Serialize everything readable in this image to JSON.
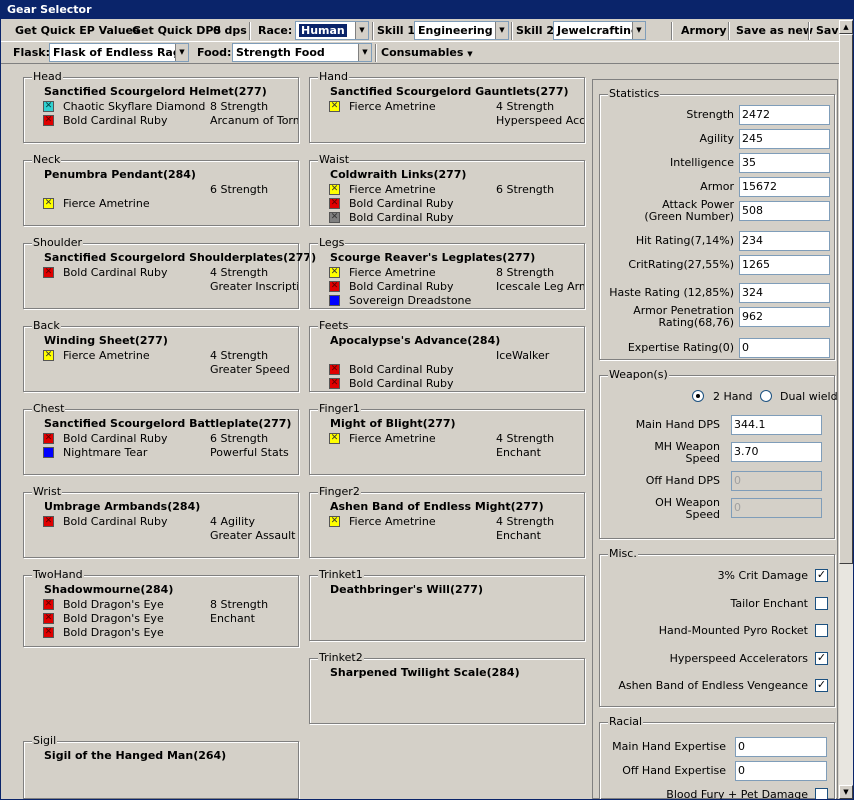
{
  "window": {
    "title": "Gear Selector"
  },
  "toolbar1": {
    "get_quick_ep": "Get Quick EP Values",
    "get_quick_dps": "Get Quick DPS",
    "dps_value": "0 dps",
    "race_label": "Race:",
    "race_value": "Human",
    "skill1_label": "Skill 1:",
    "skill1_value": "Engineering",
    "skill2_label": "Skill 2:",
    "skill2_value": "Jewelcrafting",
    "armory": "Armory",
    "save_as_new": "Save as new",
    "save": "Save"
  },
  "toolbar2": {
    "flask_label": "Flask:",
    "flask_value": "Flask of Endless Rage",
    "food_label": "Food:",
    "food_value": "Strength Food",
    "consumables": "Consumables"
  },
  "slots": {
    "head": {
      "label": "Head",
      "item": "Sanctified Scourgelord Helmet(277)",
      "gems": [
        {
          "color": "meta",
          "name": "Chaotic Skyflare Diamond"
        },
        {
          "color": "red",
          "name": "Bold Cardinal Ruby"
        }
      ],
      "right": [
        "8 Strength",
        "Arcanum of Torment"
      ]
    },
    "hand": {
      "label": "Hand",
      "item": "Sanctified Scourgelord Gauntlets(277)",
      "gems": [
        {
          "color": "yellow",
          "name": "Fierce Ametrine"
        }
      ],
      "right": [
        "4 Strength",
        "Hyperspeed Accelerators"
      ]
    },
    "neck": {
      "label": "Neck",
      "item": "Penumbra Pendant(284)",
      "gems": [
        {
          "color": "yellow",
          "name": "Fierce Ametrine"
        }
      ],
      "right": [
        "6 Strength"
      ]
    },
    "waist": {
      "label": "Waist",
      "item": "Coldwraith Links(277)",
      "gems": [
        {
          "color": "yellow",
          "name": "Fierce Ametrine"
        },
        {
          "color": "red",
          "name": "Bold Cardinal Ruby"
        },
        {
          "color": "prism",
          "name": "Bold Cardinal Ruby"
        }
      ],
      "right": [
        "6 Strength"
      ]
    },
    "shoulder": {
      "label": "Shoulder",
      "item": "Sanctified Scourgelord Shoulderplates(277)",
      "gems": [
        {
          "color": "red",
          "name": "Bold Cardinal Ruby"
        }
      ],
      "right": [
        "4 Strength",
        "Greater Inscription of the Axe"
      ]
    },
    "legs": {
      "label": "Legs",
      "item": "Scourge Reaver's Legplates(277)",
      "gems": [
        {
          "color": "yellow",
          "name": "Fierce Ametrine"
        },
        {
          "color": "red",
          "name": "Bold Cardinal Ruby"
        },
        {
          "color": "blue",
          "name": "Sovereign Dreadstone"
        }
      ],
      "right": [
        "8 Strength",
        "Icescale Leg Armor"
      ]
    },
    "back": {
      "label": "Back",
      "item": "Winding Sheet(277)",
      "gems": [
        {
          "color": "yellow",
          "name": "Fierce Ametrine"
        }
      ],
      "right": [
        "4 Strength",
        "Greater Speed"
      ]
    },
    "feet": {
      "label": "Feets",
      "item": "Apocalypse's Advance(284)",
      "gems": [
        {
          "color": "red",
          "name": "Bold Cardinal Ruby"
        },
        {
          "color": "red",
          "name": "Bold Cardinal Ruby"
        }
      ],
      "right": [
        "IceWalker"
      ]
    },
    "chest": {
      "label": "Chest",
      "item": "Sanctified Scourgelord Battleplate(277)",
      "gems": [
        {
          "color": "red",
          "name": "Bold Cardinal Ruby"
        },
        {
          "color": "blue",
          "name": "Nightmare Tear"
        }
      ],
      "right": [
        "6 Strength",
        "Powerful Stats"
      ]
    },
    "finger1": {
      "label": "Finger1",
      "item": "Might of Blight(277)",
      "gems": [
        {
          "color": "yellow",
          "name": "Fierce Ametrine"
        }
      ],
      "right": [
        "4 Strength",
        "Enchant"
      ]
    },
    "wrist": {
      "label": "Wrist",
      "item": "Umbrage Armbands(284)",
      "gems": [
        {
          "color": "red",
          "name": "Bold Cardinal Ruby"
        }
      ],
      "right": [
        "4 Agility",
        "Greater Assault"
      ]
    },
    "finger2": {
      "label": "Finger2",
      "item": "Ashen Band of Endless Might(277)",
      "gems": [
        {
          "color": "yellow",
          "name": "Fierce Ametrine"
        }
      ],
      "right": [
        "4 Strength",
        "Enchant"
      ]
    },
    "twohand": {
      "label": "TwoHand",
      "item": "Shadowmourne(284)",
      "gems": [
        {
          "color": "red",
          "name": "Bold Dragon's Eye"
        },
        {
          "color": "red",
          "name": "Bold Dragon's Eye"
        },
        {
          "color": "red",
          "name": "Bold Dragon's Eye"
        }
      ],
      "right": [
        "8 Strength",
        "Enchant"
      ]
    },
    "trinket1": {
      "label": "Trinket1",
      "item": "Deathbringer's Will(277)",
      "gems": [],
      "right": []
    },
    "trinket2": {
      "label": "Trinket2",
      "item": "Sharpened Twilight Scale(284)",
      "gems": [],
      "right": []
    },
    "sigil": {
      "label": "Sigil",
      "item": "Sigil of the Hanged Man(264)",
      "gems": [],
      "right": []
    }
  },
  "statistics": {
    "title": "Statistics",
    "rows": [
      {
        "label": "Strength",
        "value": "2472"
      },
      {
        "label": "Agility",
        "value": "245"
      },
      {
        "label": "Intelligence",
        "value": "35"
      },
      {
        "label": "Armor",
        "value": "15672"
      },
      {
        "label": "Attack Power\n(Green Number)",
        "value": "508"
      },
      {
        "label": "Hit Rating(7,14%)",
        "value": "234"
      },
      {
        "label": "CritRating(27,55%)",
        "value": "1265"
      },
      {
        "label": "Haste Rating (12,85%)",
        "value": "324"
      },
      {
        "label": "Armor Penetration\nRating(68,76)",
        "value": "962"
      },
      {
        "label": "Expertise Rating(0)",
        "value": "0"
      }
    ]
  },
  "weapons": {
    "title": "Weapon(s)",
    "two_hand": "2 Hand",
    "dual_wield": "Dual wield",
    "main_hand_dps_label": "Main Hand DPS",
    "main_hand_dps": "344.1",
    "mh_speed_label": "MH Weapon\nSpeed",
    "mh_speed": "3.70",
    "off_hand_dps_label": "Off Hand DPS",
    "off_hand_dps": "0",
    "oh_speed_label": "OH Weapon\nSpeed",
    "oh_speed": "0"
  },
  "misc": {
    "title": "Misc.",
    "items": [
      {
        "label": "3% Crit Damage",
        "checked": true
      },
      {
        "label": "Tailor Enchant",
        "checked": false
      },
      {
        "label": "Hand-Mounted Pyro Rocket",
        "checked": false
      },
      {
        "label": "Hyperspeed Accelerators",
        "checked": true
      },
      {
        "label": "Ashen Band of Endless Vengeance",
        "checked": true
      }
    ]
  },
  "racial": {
    "title": "Racial",
    "main_hand_expertise_label": "Main Hand Expertise",
    "main_hand_expertise": "0",
    "off_hand_expertise_label": "Off Hand Expertise",
    "off_hand_expertise": "0",
    "blood_fury_label": "Blood Fury + Pet Damage"
  }
}
